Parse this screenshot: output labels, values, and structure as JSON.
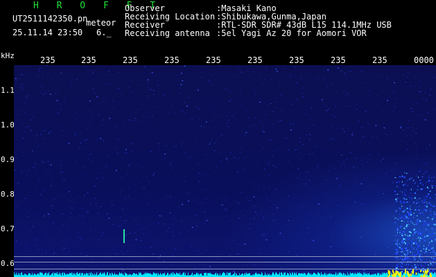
{
  "header": {
    "app_name": "H R O F F T",
    "filename": "UT2511142350.pn",
    "tag": "meteor",
    "timestamp": "25.11.14 23:50",
    "counter": "6._",
    "fields": [
      {
        "label": "Observer",
        "value": ":Masaki Kano"
      },
      {
        "label": "Receiving Location",
        "value": ":Shibukawa,Gunma,Japan"
      },
      {
        "label": "Receiver",
        "value": ":RTL-SDR SDR# 43dB L15 114.1MHz USB"
      },
      {
        "label": "Receiving antenna",
        "value": ":5el Yagi Az 20 for Aomori VOR"
      }
    ]
  },
  "axis": {
    "unit": "kHz",
    "y_ticks": [
      "1.1",
      "1.0",
      "0.9",
      "0.8",
      "0.7",
      "0.6"
    ],
    "x_ticks": [
      "235",
      "235",
      "235",
      "235",
      "235",
      "235",
      "235",
      "235",
      "235",
      "0000"
    ]
  },
  "colors": {
    "background": "#000000",
    "plot_base": "#0a0f5c",
    "noise": "#1e3cff",
    "signal": "#00e8ff",
    "highlight": "#ffff00",
    "title_green": "#22e03a"
  }
}
